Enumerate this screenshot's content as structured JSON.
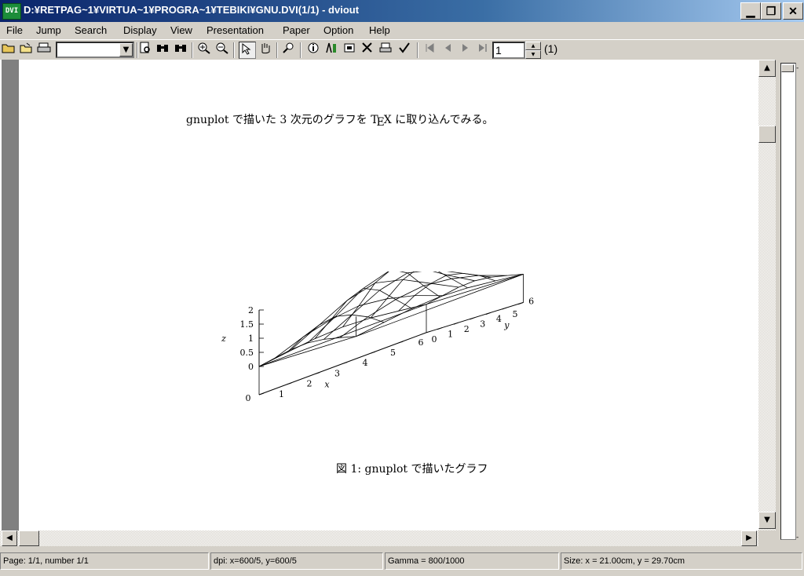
{
  "window": {
    "icon_label": "DVI",
    "title": "D:¥RETPAG~1¥VIRTUA~1¥PROGRA~1¥TEBIKI¥GNU.DVI(1/1) - dviout",
    "buttons": {
      "minimize": "▁",
      "restore": "❐",
      "close": "✕"
    }
  },
  "menu": [
    {
      "label": "File"
    },
    {
      "label": "Jump"
    },
    {
      "label": "Search"
    },
    {
      "label": "Display"
    },
    {
      "label": "View"
    },
    {
      "label": "Presentation"
    },
    {
      "label": "Paper"
    },
    {
      "label": "Option"
    },
    {
      "label": "Help"
    }
  ],
  "toolbar": {
    "page_value": "1",
    "page_total": "(1)",
    "combo_value": ""
  },
  "document": {
    "line_before": "gnuplot で描いた 3 次元のグラフを ",
    "tex_T": "T",
    "tex_E": "E",
    "tex_X": "X",
    "line_after": " に取り込んでみる。",
    "caption": "図 1: gnuplot で描いたグラフ"
  },
  "chart_data": {
    "type": "surface3d",
    "title": "",
    "xlabel": "x",
    "ylabel": "y",
    "zlabel": "z",
    "x_ticks": [
      "0",
      "1",
      "2",
      "3",
      "4",
      "5",
      "6"
    ],
    "y_ticks": [
      "0",
      "1",
      "2",
      "3",
      "4",
      "5",
      "6"
    ],
    "z_ticks": [
      "0",
      "0.5",
      "1",
      "1.5",
      "2"
    ],
    "xlim": [
      0,
      6
    ],
    "ylim": [
      0,
      6
    ],
    "zlim": [
      0,
      2
    ],
    "grid_x": [
      0,
      1,
      2,
      3,
      4,
      5,
      6
    ],
    "grid_y": [
      0,
      1,
      2,
      3,
      4,
      5,
      6
    ],
    "z_values": [
      [
        0.0,
        0.13,
        0.25,
        0.3,
        0.25,
        0.13,
        0.0
      ],
      [
        0.13,
        0.5,
        0.75,
        0.87,
        0.75,
        0.5,
        0.13
      ],
      [
        0.25,
        0.75,
        1.25,
        1.5,
        1.25,
        0.75,
        0.25
      ],
      [
        0.3,
        0.87,
        1.5,
        1.8,
        1.5,
        0.87,
        0.3
      ],
      [
        0.25,
        0.75,
        1.25,
        1.5,
        1.25,
        0.75,
        0.25
      ],
      [
        0.13,
        0.5,
        0.75,
        0.87,
        0.75,
        0.5,
        0.13
      ],
      [
        0.0,
        0.13,
        0.25,
        0.3,
        0.25,
        0.13,
        0.0
      ]
    ]
  },
  "status": {
    "page": "Page: 1/1, number 1/1",
    "dpi": "dpi: x=600/5, y=600/5",
    "gamma": "Gamma = 800/1000",
    "size": "Size: x = 21.00cm, y = 29.70cm"
  },
  "right_panel": {
    "top_tick": "-",
    "bottom_tick": "-"
  }
}
